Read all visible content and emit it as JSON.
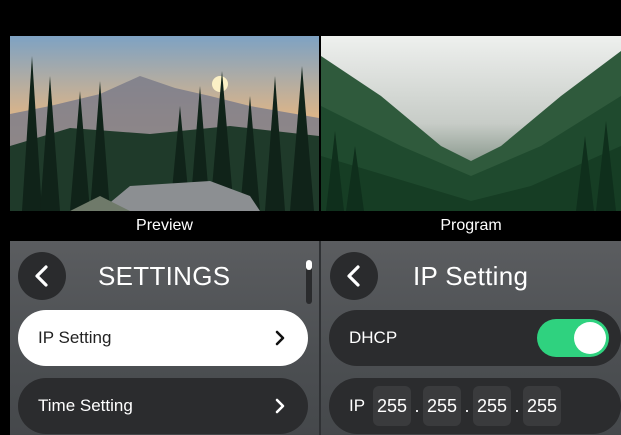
{
  "preview": {
    "caption": "Preview"
  },
  "program": {
    "caption": "Program"
  },
  "settings": {
    "title": "SETTINGS",
    "items": [
      {
        "label": "IP Setting",
        "selected": true
      },
      {
        "label": "Time Setting",
        "selected": false
      }
    ]
  },
  "ip_setting": {
    "title": "IP Setting",
    "dhcp": {
      "label": "DHCP",
      "enabled": true
    },
    "ip": {
      "label": "IP",
      "octets": [
        "255",
        "255",
        "255",
        "255"
      ]
    }
  },
  "colors": {
    "toggle_on": "#2fd27f",
    "button_dark": "#2a2b2d",
    "row_dark": "#2b2c2e",
    "row_selected": "#ffffff"
  },
  "icons": [
    "back-chevron-icon",
    "chevron-right-icon"
  ]
}
